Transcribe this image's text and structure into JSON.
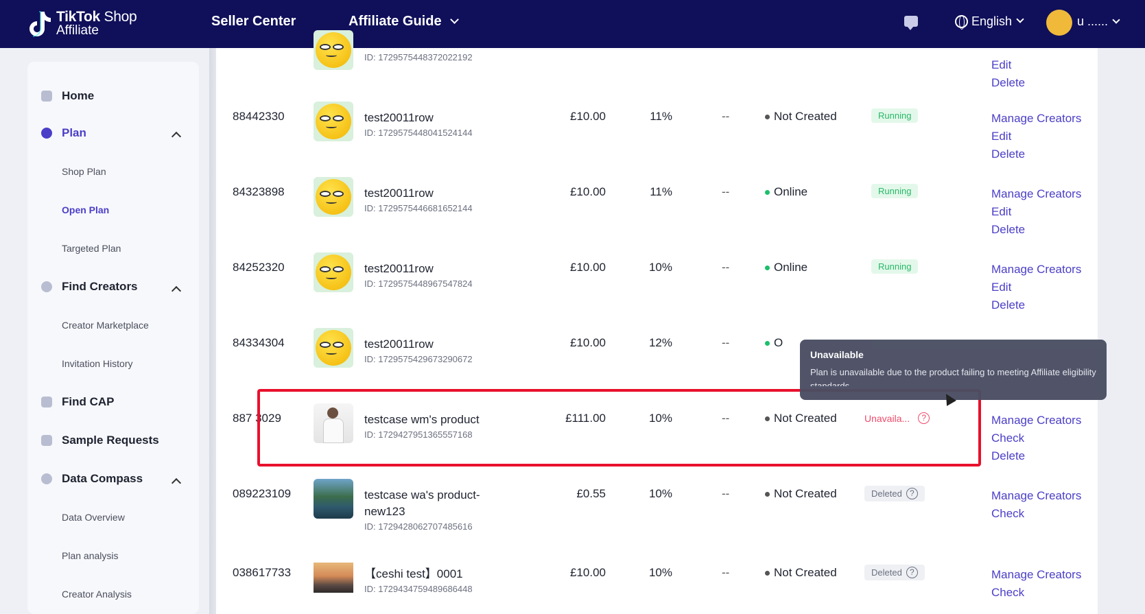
{
  "header": {
    "logo_brand": "TikTok",
    "logo_shop": "Shop",
    "logo_sub": "Affiliate",
    "nav": [
      "Seller Center",
      "Affiliate Guide"
    ],
    "language": "English",
    "user": "u ......",
    "icons": [
      "tiktok-logo-icon",
      "message-icon",
      "globe-icon",
      "chevron-down-icon"
    ]
  },
  "sidebar": {
    "home": "Home",
    "plan": "Plan",
    "plan_items": [
      "Shop Plan",
      "Open Plan",
      "Targeted Plan"
    ],
    "find_creators": "Find Creators",
    "find_creators_items": [
      "Creator Marketplace",
      "Invitation History"
    ],
    "find_cap": "Find CAP",
    "sample_requests": "Sample Requests",
    "data_compass": "Data Compass",
    "data_compass_items": [
      "Data Overview",
      "Plan analysis",
      "Creator Analysis"
    ]
  },
  "rows": [
    {
      "id": "",
      "name": "",
      "pid": "ID: 1729575448372022192",
      "price": "",
      "rate": "",
      "dash": "",
      "status": "",
      "badge": "",
      "actions": [
        "Edit",
        "Delete"
      ]
    },
    {
      "id": "88442330",
      "name": "test20011row",
      "pid": "ID: 1729575448041524144",
      "price": "£10.00",
      "rate": "11%",
      "dash": "--",
      "status": "Not Created",
      "badge": "Running",
      "actions": [
        "Manage Creators",
        "Edit",
        "Delete"
      ]
    },
    {
      "id": "84323898",
      "name": "test20011row",
      "pid": "ID: 1729575446681652144",
      "price": "£10.00",
      "rate": "11%",
      "dash": "--",
      "status": "Online",
      "badge": "Running",
      "actions": [
        "Manage Creators",
        "Edit",
        "Delete"
      ]
    },
    {
      "id": "84252320",
      "name": "test20011row",
      "pid": "ID: 1729575448967547824",
      "price": "£10.00",
      "rate": "10%",
      "dash": "--",
      "status": "Online",
      "badge": "Running",
      "actions": [
        "Manage Creators",
        "Edit",
        "Delete"
      ]
    },
    {
      "id": "84334304",
      "name": "test20011row",
      "pid": "ID: 1729575429673290672",
      "price": "£10.00",
      "rate": "12%",
      "dash": "--",
      "status": "O",
      "badge": "",
      "actions": []
    },
    {
      "id": "887 3029",
      "name": "testcase wm's product",
      "pid": "ID: 1729427951365557168",
      "price": "£111.00",
      "rate": "10%",
      "dash": "--",
      "status": "Not Created",
      "badge": "Unavaila...",
      "actions": [
        "Manage Creators",
        "Check",
        "Delete"
      ]
    },
    {
      "id": "089223109",
      "name": "testcase wa's product-new123",
      "pid": "ID: 1729428062707485616",
      "price": "£0.55",
      "rate": "10%",
      "dash": "--",
      "status": "Not Created",
      "badge": "Deleted",
      "actions": [
        "Manage Creators",
        "Check"
      ]
    },
    {
      "id": "038617733",
      "name": "【ceshi test】0001",
      "pid": "ID: 1729434759489686448",
      "price": "£10.00",
      "rate": "10%",
      "dash": "--",
      "status": "Not Created",
      "badge": "Deleted",
      "actions": [
        "Manage Creators",
        "Check"
      ]
    }
  ],
  "tooltip": {
    "title": "Unavailable",
    "body": "Plan is unavailable due to the product failing to meeting Affiliate eligibility standards"
  },
  "help_glyph": "?"
}
